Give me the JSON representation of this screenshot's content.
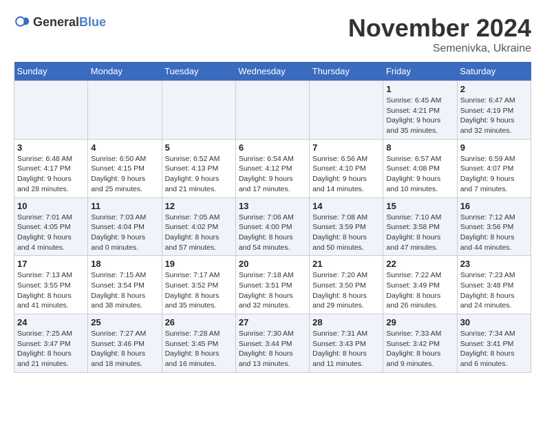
{
  "header": {
    "logo_general": "General",
    "logo_blue": "Blue",
    "month_title": "November 2024",
    "location": "Semenivka, Ukraine"
  },
  "days_of_week": [
    "Sunday",
    "Monday",
    "Tuesday",
    "Wednesday",
    "Thursday",
    "Friday",
    "Saturday"
  ],
  "weeks": [
    [
      {
        "day": "",
        "info": ""
      },
      {
        "day": "",
        "info": ""
      },
      {
        "day": "",
        "info": ""
      },
      {
        "day": "",
        "info": ""
      },
      {
        "day": "",
        "info": ""
      },
      {
        "day": "1",
        "info": "Sunrise: 6:45 AM\nSunset: 4:21 PM\nDaylight: 9 hours and 35 minutes."
      },
      {
        "day": "2",
        "info": "Sunrise: 6:47 AM\nSunset: 4:19 PM\nDaylight: 9 hours and 32 minutes."
      }
    ],
    [
      {
        "day": "3",
        "info": "Sunrise: 6:48 AM\nSunset: 4:17 PM\nDaylight: 9 hours and 28 minutes."
      },
      {
        "day": "4",
        "info": "Sunrise: 6:50 AM\nSunset: 4:15 PM\nDaylight: 9 hours and 25 minutes."
      },
      {
        "day": "5",
        "info": "Sunrise: 6:52 AM\nSunset: 4:13 PM\nDaylight: 9 hours and 21 minutes."
      },
      {
        "day": "6",
        "info": "Sunrise: 6:54 AM\nSunset: 4:12 PM\nDaylight: 9 hours and 17 minutes."
      },
      {
        "day": "7",
        "info": "Sunrise: 6:56 AM\nSunset: 4:10 PM\nDaylight: 9 hours and 14 minutes."
      },
      {
        "day": "8",
        "info": "Sunrise: 6:57 AM\nSunset: 4:08 PM\nDaylight: 9 hours and 10 minutes."
      },
      {
        "day": "9",
        "info": "Sunrise: 6:59 AM\nSunset: 4:07 PM\nDaylight: 9 hours and 7 minutes."
      }
    ],
    [
      {
        "day": "10",
        "info": "Sunrise: 7:01 AM\nSunset: 4:05 PM\nDaylight: 9 hours and 4 minutes."
      },
      {
        "day": "11",
        "info": "Sunrise: 7:03 AM\nSunset: 4:04 PM\nDaylight: 9 hours and 0 minutes."
      },
      {
        "day": "12",
        "info": "Sunrise: 7:05 AM\nSunset: 4:02 PM\nDaylight: 8 hours and 57 minutes."
      },
      {
        "day": "13",
        "info": "Sunrise: 7:06 AM\nSunset: 4:00 PM\nDaylight: 8 hours and 54 minutes."
      },
      {
        "day": "14",
        "info": "Sunrise: 7:08 AM\nSunset: 3:59 PM\nDaylight: 8 hours and 50 minutes."
      },
      {
        "day": "15",
        "info": "Sunrise: 7:10 AM\nSunset: 3:58 PM\nDaylight: 8 hours and 47 minutes."
      },
      {
        "day": "16",
        "info": "Sunrise: 7:12 AM\nSunset: 3:56 PM\nDaylight: 8 hours and 44 minutes."
      }
    ],
    [
      {
        "day": "17",
        "info": "Sunrise: 7:13 AM\nSunset: 3:55 PM\nDaylight: 8 hours and 41 minutes."
      },
      {
        "day": "18",
        "info": "Sunrise: 7:15 AM\nSunset: 3:54 PM\nDaylight: 8 hours and 38 minutes."
      },
      {
        "day": "19",
        "info": "Sunrise: 7:17 AM\nSunset: 3:52 PM\nDaylight: 8 hours and 35 minutes."
      },
      {
        "day": "20",
        "info": "Sunrise: 7:18 AM\nSunset: 3:51 PM\nDaylight: 8 hours and 32 minutes."
      },
      {
        "day": "21",
        "info": "Sunrise: 7:20 AM\nSunset: 3:50 PM\nDaylight: 8 hours and 29 minutes."
      },
      {
        "day": "22",
        "info": "Sunrise: 7:22 AM\nSunset: 3:49 PM\nDaylight: 8 hours and 26 minutes."
      },
      {
        "day": "23",
        "info": "Sunrise: 7:23 AM\nSunset: 3:48 PM\nDaylight: 8 hours and 24 minutes."
      }
    ],
    [
      {
        "day": "24",
        "info": "Sunrise: 7:25 AM\nSunset: 3:47 PM\nDaylight: 8 hours and 21 minutes."
      },
      {
        "day": "25",
        "info": "Sunrise: 7:27 AM\nSunset: 3:46 PM\nDaylight: 8 hours and 18 minutes."
      },
      {
        "day": "26",
        "info": "Sunrise: 7:28 AM\nSunset: 3:45 PM\nDaylight: 8 hours and 16 minutes."
      },
      {
        "day": "27",
        "info": "Sunrise: 7:30 AM\nSunset: 3:44 PM\nDaylight: 8 hours and 13 minutes."
      },
      {
        "day": "28",
        "info": "Sunrise: 7:31 AM\nSunset: 3:43 PM\nDaylight: 8 hours and 11 minutes."
      },
      {
        "day": "29",
        "info": "Sunrise: 7:33 AM\nSunset: 3:42 PM\nDaylight: 8 hours and 9 minutes."
      },
      {
        "day": "30",
        "info": "Sunrise: 7:34 AM\nSunset: 3:41 PM\nDaylight: 8 hours and 6 minutes."
      }
    ]
  ]
}
